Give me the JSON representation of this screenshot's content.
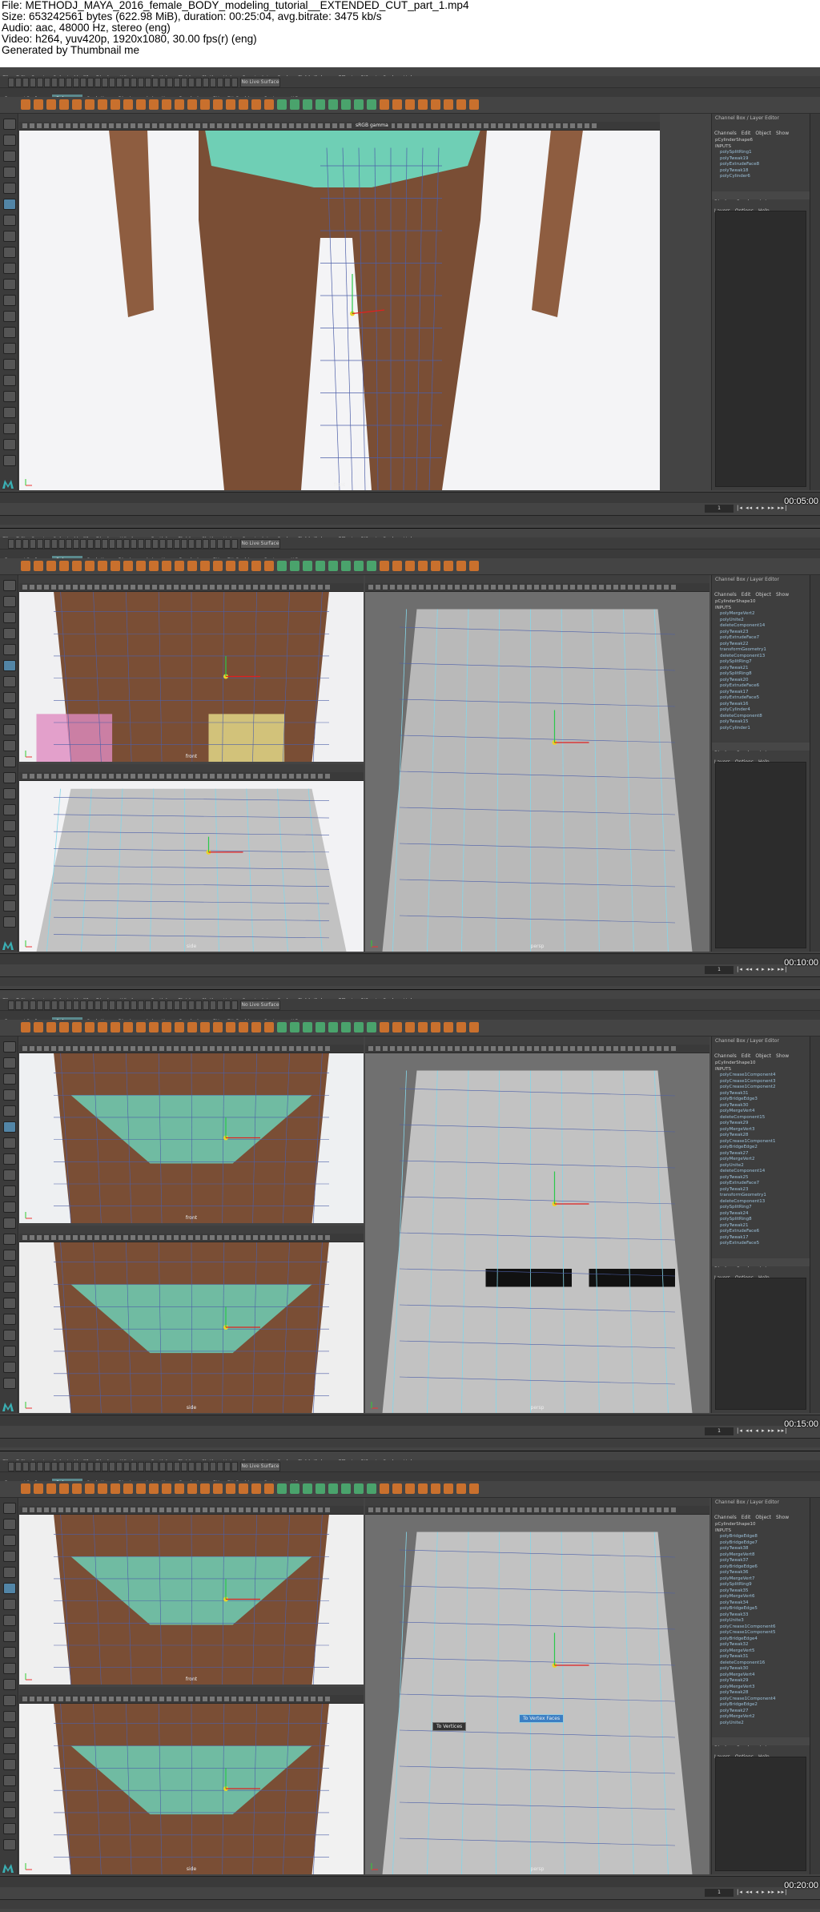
{
  "header": {
    "file": "File: METHODJ_MAYA_2016_female_BODY_modeling_tutorial__EXTENDED_CUT_part_1.mp4",
    "size": "Size: 653242561 bytes (622.98 MiB), duration: 00:25:04, avg.bitrate: 3475 kb/s",
    "audio": "Audio: aac, 48000 Hz, stereo (eng)",
    "video": "Video: h264, yuv420p, 1920x1080, 30.00 fps(r) (eng)",
    "generated": "Generated by Thumbnail me"
  },
  "ui": {
    "menu": [
      "File",
      "Edit",
      "Create",
      "Select",
      "Modify",
      "Display",
      "Windows",
      "nParticles",
      "Fluids",
      "nCloth",
      "nHair",
      "nConstraint",
      "nCache",
      "Fields/Solvers",
      "Effects",
      "Bifrost",
      "Cache",
      "Help"
    ],
    "no_live_surface": "No Live Surface",
    "shelf_tabs": [
      "Curves / Surfaces",
      "Polygons",
      "Sculpting",
      "Rigging",
      "Animation",
      "Rendering",
      "FX",
      "FX Caching",
      "Custom",
      "XGen"
    ],
    "active_shelf": "Polygons",
    "viewport_menu": [
      "View",
      "Shading",
      "Lighting",
      "Show",
      "Renderer",
      "Panels"
    ],
    "gamma_label": "sRGB gamma",
    "panel_header": "Channel Box / Layer Editor",
    "panel_tabs": [
      "Channels",
      "Edit",
      "Object",
      "Show"
    ],
    "layer_tabs": [
      "Display",
      "Render",
      "Anim"
    ],
    "layer_sub": [
      "Layers",
      "Options",
      "Help"
    ],
    "cam_front": "front",
    "cam_persp": "persp",
    "cam_side": "side",
    "frame_field": "1",
    "playback": "|◂ ◂◂ ◂ ▸ ▸▸ ▸▸|"
  },
  "frames": [
    {
      "timecode": "00:05:00",
      "shape_node": "pCylinderShape6",
      "inputs_label": "INPUTS",
      "history": [
        "polySplitRing1",
        "polyTweak19",
        "polyExtrudeFace8",
        "polyTweak18",
        "polyCylinder6"
      ]
    },
    {
      "timecode": "00:10:00",
      "shape_node": "pCylinderShape10",
      "inputs_label": "INPUTS",
      "history": [
        "polyMergeVert2",
        "polyUnite2",
        "deleteComponent14",
        "polyTweak23",
        "polyExtrudeFace7",
        "polyTweak22",
        "transformGeometry1",
        "deleteComponent13",
        "polySplitRing7",
        "polyTweak21",
        "polySplitRing8",
        "polyTweak20",
        "polyExtrudeFace6",
        "polyTweak17",
        "polyExtrudeFace5",
        "polyTweak16",
        "polyCylinder4",
        "deleteComponent8",
        "polyTweak15",
        "polyCylinder1"
      ]
    },
    {
      "timecode": "00:15:00",
      "shape_node": "pCylinderShape10",
      "inputs_label": "INPUTS",
      "history": [
        "polyCrease1Component4",
        "polyCrease1Component3",
        "polyCrease1Component2",
        "polyTweak31",
        "polyBridgeEdge3",
        "polyTweak30",
        "polyMergeVert4",
        "deleteComponent15",
        "polyTweak29",
        "polyMergeVert3",
        "polyTweak28",
        "polyCrease1Component1",
        "polyBridgeEdge2",
        "polyTweak27",
        "polyMergeVert2",
        "polyUnite2",
        "deleteComponent14",
        "polyTweak25",
        "polyExtrudeFace7",
        "polyTweak23",
        "transformGeometry1",
        "deleteComponent13",
        "polySplitRing7",
        "polyTweak24",
        "polySplitRing8",
        "polyTweak21",
        "polyExtrudeFace6",
        "polyTweak17",
        "polyExtrudeFace5"
      ]
    },
    {
      "timecode": "00:20:00",
      "shape_node": "pCylinderShape10",
      "inputs_label": "INPUTS",
      "history": [
        "polyBridgeEdge8",
        "polyBridgeEdge7",
        "polyTweak38",
        "polyMergeVert8",
        "polyTweak37",
        "polyBridgeEdge6",
        "polyTweak36",
        "polyMergeVert7",
        "polySplitRing9",
        "polyTweak35",
        "polyMergeVert6",
        "polyTweak34",
        "polyBridgeEdge5",
        "polyTweak33",
        "polyUnite3",
        "polyCrease1Component6",
        "polyCrease1Component5",
        "polyBridgeEdge4",
        "polyTweak32",
        "polyMergeVert5",
        "polyTweak31",
        "deleteComponent16",
        "polyTweak30",
        "polyMergeVert4",
        "polyTweak29",
        "polyMergeVert3",
        "polyTweak28",
        "polyCrease1Component4",
        "polyBridgeEdge2",
        "polyTweak27",
        "polyMergeVert2",
        "polyUnite2"
      ],
      "tooltip_left": "To Vertices",
      "tooltip_right": "To Vertex Faces"
    }
  ]
}
